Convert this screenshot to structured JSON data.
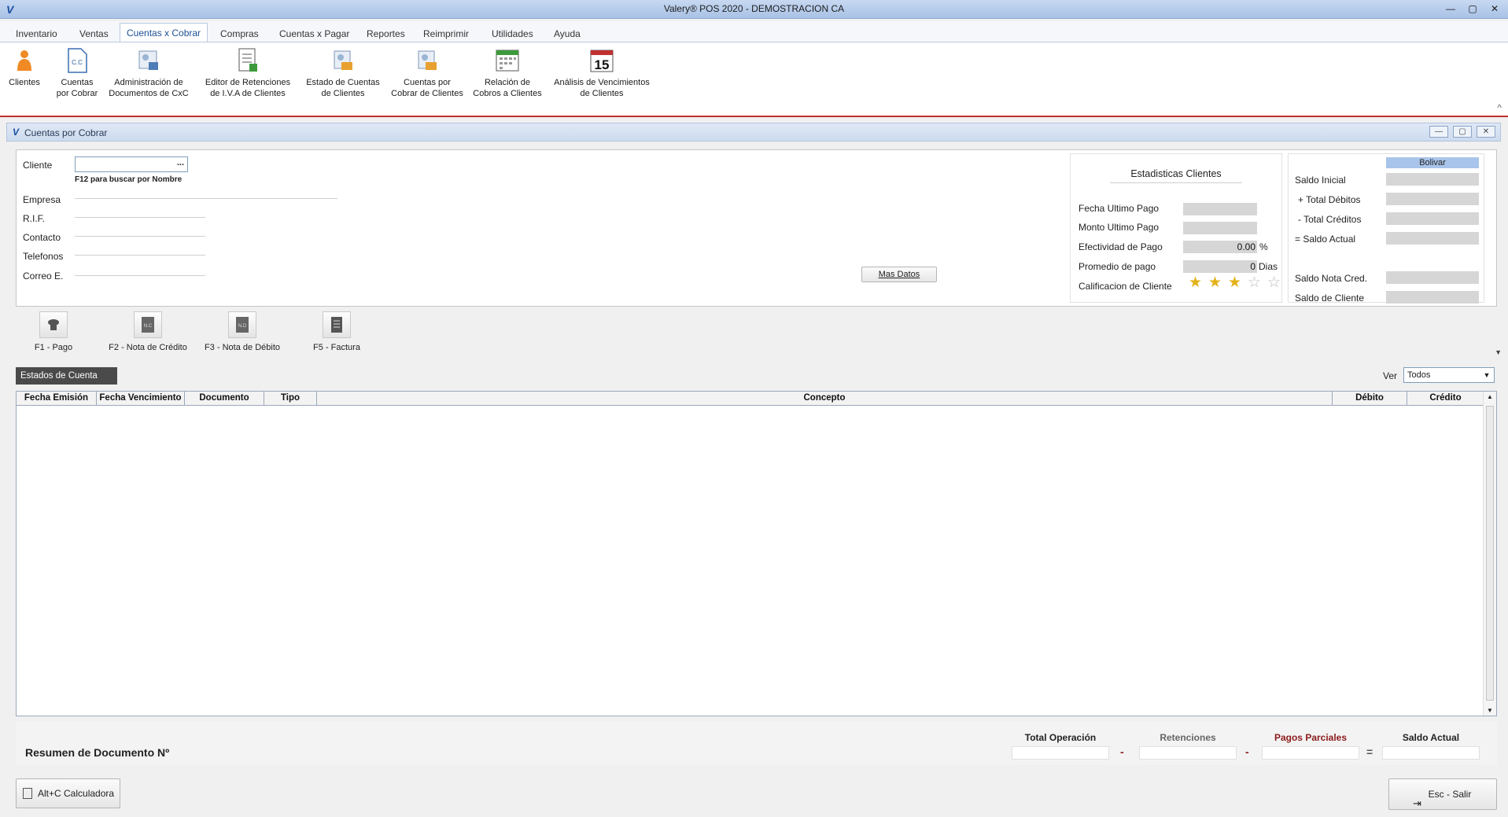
{
  "window": {
    "title": "Valery® POS 2020 - DEMOSTRACION CA",
    "minimize": "—",
    "restore": "▢",
    "close": "✕",
    "app_icon": "V"
  },
  "menu": [
    "Inventario",
    "Ventas",
    "Cuentas x Cobrar",
    "Compras",
    "Cuentas x Pagar",
    "Reportes",
    "Reimprimir",
    "Utilidades",
    "Ayuda"
  ],
  "ribbon": {
    "items": [
      {
        "label1": "Clientes",
        "label2": "",
        "icon": "person-icon"
      },
      {
        "label1": "Cuentas",
        "label2": "por Cobrar",
        "icon": "cxc-document-icon",
        "icon_text": "C.C"
      },
      {
        "label1": "Administración de",
        "label2": "Documentos de CxC",
        "icon": "document-admin-icon"
      },
      {
        "label1": "Editor de Retenciones",
        "label2": "de I.V.A de Clientes",
        "icon": "tax-editor-icon"
      },
      {
        "label1": "Estado de Cuentas",
        "label2": "de Clientes",
        "icon": "account-state-icon"
      },
      {
        "label1": "Cuentas por",
        "label2": "Cobrar de Clientes",
        "icon": "receivables-icon"
      },
      {
        "label1": "Relación de",
        "label2": "Cobros a Clientes",
        "icon": "calendar-icon"
      },
      {
        "label1": "Análisis de Vencimientos",
        "label2": "de Clientes",
        "icon": "calendar-15-icon",
        "icon_text": "15"
      }
    ],
    "collapse": "^"
  },
  "child": {
    "title": "Cuentas por Cobrar",
    "icon": "V",
    "min": "—",
    "max": "▢",
    "close": "✕"
  },
  "client": {
    "cliente_label": "Cliente",
    "browse": "...",
    "hint": "F12 para buscar por Nombre",
    "empresa": "Empresa",
    "rif": "R.I.F.",
    "contacto": "Contacto",
    "telefonos": "Telefonos",
    "correo": "Correo E.",
    "mas_datos": "Mas Datos"
  },
  "stats": {
    "title": "Estadisticas Clientes",
    "fecha_ultimo_pago": "Fecha Ultimo Pago",
    "monto_ultimo_pago": "Monto Ultimo Pago",
    "efectividad": "Efectividad de Pago",
    "efectividad_value": "0.00",
    "efectividad_unit": "%",
    "promedio": "Promedio de pago",
    "promedio_value": "0",
    "promedio_unit": "Dias",
    "calificacion": "Calificacion de Cliente",
    "rating": 3,
    "rating_max": 5
  },
  "balance": {
    "currency": "Bolivar",
    "saldo_inicial": "Saldo Inicial",
    "total_debitos": "+ Total Débitos",
    "total_creditos": "-  Total Créditos",
    "saldo_actual": "= Saldo Actual",
    "saldo_nota_cred": "Saldo Nota Cred.",
    "saldo_cliente": "Saldo de Cliente"
  },
  "actions": [
    {
      "label": "F1 - Pago",
      "icon": "payment-icon"
    },
    {
      "label": "F2 - Nota de Crédito",
      "icon": "credit-note-icon",
      "icon_text": "N.C"
    },
    {
      "label": "F3 - Nota de Débito",
      "icon": "debit-note-icon",
      "icon_text": "N.D"
    },
    {
      "label": "F5 - Factura",
      "icon": "invoice-icon"
    }
  ],
  "estados_tab": "Estados de Cuenta",
  "ver_label": "Ver",
  "ver_value": "Todos",
  "grid": {
    "columns": [
      "Fecha Emisión",
      "Fecha Vencimiento",
      "Documento",
      "Tipo",
      "Concepto",
      "Débito",
      "Crédito"
    ],
    "rows": []
  },
  "summary": {
    "title": "Resumen de Documento Nº",
    "total_operacion": "Total Operación",
    "retenciones": "Retenciones",
    "pagos_parciales": "Pagos Parciales",
    "saldo_actual": "Saldo Actual",
    "minus": "-",
    "equals": "="
  },
  "footer": {
    "calc": "Alt+C Calculadora",
    "exit": "Esc - Salir"
  },
  "colors": {
    "accent": "#1e4f94",
    "ribbon_border": "#c03030",
    "star_on": "#e3b21a",
    "pagos_parciales": "#8b1a1a",
    "retenciones": "#666666"
  }
}
